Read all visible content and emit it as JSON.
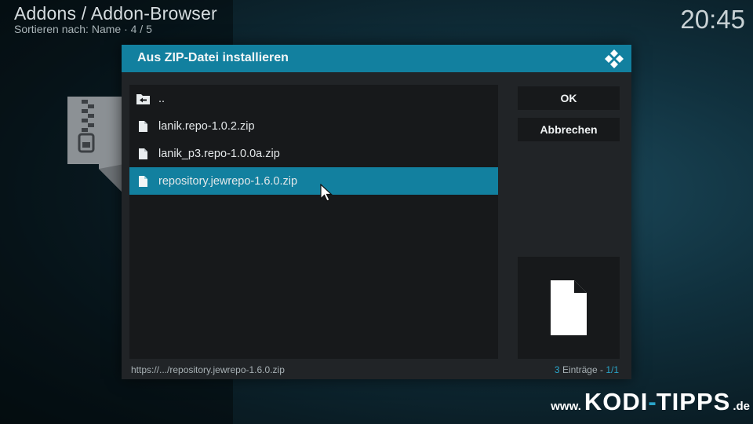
{
  "header": {
    "title": "Addons / Addon-Browser",
    "subtitle": "Sortieren nach: Name  ·  4 / 5",
    "clock": "20:45"
  },
  "dialog": {
    "title": "Aus ZIP-Datei installieren",
    "items": [
      {
        "label": "..",
        "icon": "folder-back-icon"
      },
      {
        "label": "lanik.repo-1.0.2.zip",
        "icon": "file-icon"
      },
      {
        "label": "lanik_p3.repo-1.0.0a.zip",
        "icon": "file-icon"
      },
      {
        "label": "repository.jewrepo-1.6.0.zip",
        "icon": "file-icon",
        "selected": true
      }
    ],
    "ok_label": "OK",
    "cancel_label": "Abbrechen",
    "footer_path": "https://.../repository.jewrepo-1.6.0.zip",
    "count_number": "3",
    "count_rest": " Einträge - ",
    "count_page": "1/1"
  },
  "watermark": {
    "www": "www.",
    "kodi": "KODI",
    "dash": "-",
    "tipps": "TIPPS",
    "tld": ".de"
  },
  "colors": {
    "accent": "#12809f",
    "panel": "#212427",
    "panel_dark": "#17191b"
  }
}
